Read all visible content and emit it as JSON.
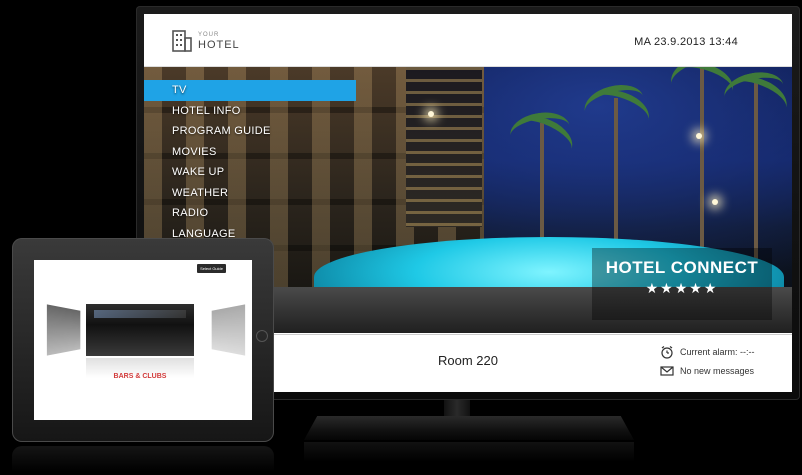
{
  "tv": {
    "brand": {
      "small": "YOUR",
      "big": "HOTEL"
    },
    "datetime": "MA 23.9.2013 13:44",
    "menu": [
      {
        "label": "TV",
        "active": true
      },
      {
        "label": "HOTEL INFO",
        "active": false
      },
      {
        "label": "PROGRAM GUIDE",
        "active": false
      },
      {
        "label": "MOVIES",
        "active": false
      },
      {
        "label": "WAKE UP",
        "active": false
      },
      {
        "label": "WEATHER",
        "active": false
      },
      {
        "label": "RADIO",
        "active": false
      },
      {
        "label": "LANGUAGE",
        "active": false
      }
    ],
    "hero": {
      "title": "HOTEL CONNECT",
      "stars": "★★★★★"
    },
    "footer": {
      "room": "Room 220",
      "alarm": "Current alarm: --:--",
      "messages": "No new messages"
    },
    "colors": {
      "accent": "#1fa3e6"
    }
  },
  "tablet": {
    "tag": "Select Guide",
    "gallery_label": "BARS & CLUBS",
    "label_color": "#d23a3a"
  }
}
